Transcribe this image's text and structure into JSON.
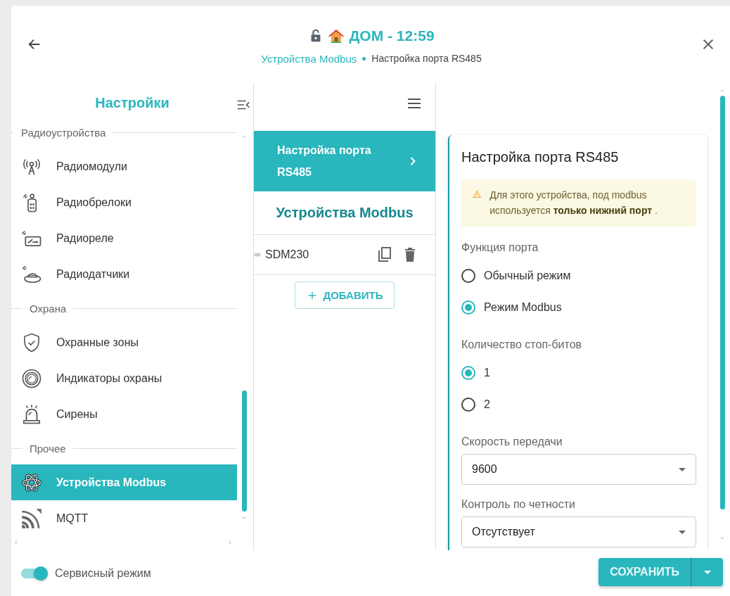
{
  "header": {
    "title": "ДОМ - 12:59",
    "breadcrumb": [
      {
        "label": "Устройства Modbus",
        "current": false
      },
      {
        "label": "Настройка порта RS485",
        "current": true
      }
    ]
  },
  "sidebar": {
    "title": "Настройки",
    "items": [
      {
        "kind": "section",
        "label": "Радиоустройства"
      },
      {
        "kind": "item",
        "label": "Радиомодули",
        "selected": false
      },
      {
        "kind": "item",
        "label": "Радиобрелоки",
        "selected": false
      },
      {
        "kind": "item",
        "label": "Радиореле",
        "selected": false
      },
      {
        "kind": "item",
        "label": "Радиодатчики",
        "selected": false
      },
      {
        "kind": "section",
        "label": "Охрана"
      },
      {
        "kind": "item",
        "label": "Охранные зоны",
        "selected": false
      },
      {
        "kind": "item",
        "label": "Индикаторы охраны",
        "selected": false
      },
      {
        "kind": "item",
        "label": "Сирены",
        "selected": false
      },
      {
        "kind": "section",
        "label": "Прочее"
      },
      {
        "kind": "item",
        "label": "Устройства Modbus",
        "selected": true
      },
      {
        "kind": "item",
        "label": "MQTT",
        "selected": false
      }
    ]
  },
  "middle": {
    "nav": [
      {
        "label": "Настройка порта RS485",
        "selected": true
      }
    ],
    "title": "Устройства Modbus",
    "devices": [
      {
        "name": "SDM230"
      }
    ],
    "add_button": "ДОБАВИТЬ"
  },
  "card": {
    "title": "Настройка порта RS485",
    "alert": "Для этого устройства, под modbus используется **только нижний порт** .",
    "fields": [
      {
        "kind": "radio",
        "label": "Функция порта",
        "options": [
          {
            "label": "Обычный режим",
            "selected": false
          },
          {
            "label": "Режим Modbus",
            "selected": true
          }
        ]
      },
      {
        "kind": "radio",
        "label": "Количество стоп-битов",
        "options": [
          {
            "label": "1",
            "selected": true
          },
          {
            "label": "2",
            "selected": false
          }
        ]
      },
      {
        "kind": "select",
        "label": "Скорость передачи",
        "value": "9600"
      },
      {
        "kind": "select",
        "label": "Контроль по четности",
        "value": "Отсутствует"
      }
    ]
  },
  "footer": {
    "service_mode": {
      "label": "Сервисный режим",
      "on": true
    },
    "save_button": "СОХРАНИТЬ"
  }
}
